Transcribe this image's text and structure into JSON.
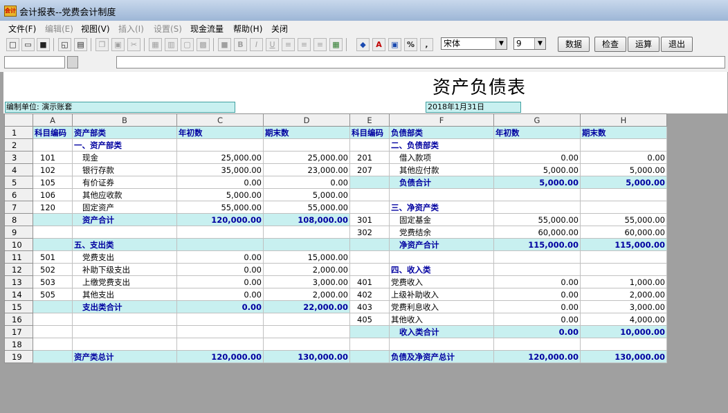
{
  "window": {
    "title": "会计报表--党费会计制度",
    "app_icon_text": "会计"
  },
  "menu": [
    {
      "label": "文件(F)",
      "enabled": true
    },
    {
      "label": "编辑(E)",
      "enabled": false
    },
    {
      "label": "视图(V)",
      "enabled": true
    },
    {
      "label": "插入(I)",
      "enabled": false
    },
    {
      "label": "设置(S)",
      "enabled": false
    },
    {
      "label": "现金流量",
      "enabled": true
    },
    {
      "label": "帮助(H)",
      "enabled": true
    },
    {
      "label": "关闭",
      "enabled": true
    }
  ],
  "toolbar": {
    "icons": [
      "new-icon",
      "open-icon",
      "save-icon",
      "print-preview-icon",
      "print-icon",
      "copy-icon",
      "paste-icon",
      "cut-icon",
      "merge-icon",
      "align-icon",
      "border-icon",
      "style-icon",
      "fill-icon",
      "bold-icon",
      "italic-icon",
      "underline-icon",
      "align-left-icon",
      "align-center-icon",
      "align-right-icon",
      "grid-icon",
      "fill-color-icon",
      "font-color-icon",
      "format-icon",
      "percent-icon",
      "comma-icon"
    ],
    "bold_glyph": "B",
    "italic_glyph": "I",
    "underline_glyph": "U",
    "percent_glyph": "%",
    "comma_glyph": ",",
    "font_name": "宋体",
    "font_size": "9",
    "data_button": "数据",
    "check_button": "检查",
    "calc_button": "运算",
    "exit_button": "退出"
  },
  "formula_bar": {
    "cell_ref": "",
    "formula": ""
  },
  "report": {
    "title": "资产负债表",
    "unit_label": "编制单位: 演示账套",
    "date": "2018年1月31日"
  },
  "columns": [
    "A",
    "B",
    "C",
    "D",
    "E",
    "F",
    "G",
    "H"
  ],
  "rows": [
    {
      "n": "1",
      "a": "科目编码",
      "b": "资产部类",
      "c": "年初数",
      "d": "期末数",
      "e": "科目编码",
      "f": "负债部类",
      "g": "年初数",
      "h": "期末数"
    },
    {
      "n": "2",
      "a": "",
      "b": "一、资产部类",
      "c": "",
      "d": "",
      "e": "",
      "f": "二、负债部类",
      "g": "",
      "h": ""
    },
    {
      "n": "3",
      "a": "101",
      "b": "现金",
      "c": "25,000.00",
      "d": "25,000.00",
      "e": "201",
      "f": "借入款项",
      "g": "0.00",
      "h": "0.00"
    },
    {
      "n": "4",
      "a": "102",
      "b": "银行存款",
      "c": "35,000.00",
      "d": "23,000.00",
      "e": "207",
      "f": "其他应付款",
      "g": "5,000.00",
      "h": "5,000.00"
    },
    {
      "n": "5",
      "a": "105",
      "b": "有价证券",
      "c": "0.00",
      "d": "0.00",
      "e": "",
      "f": "负债合计",
      "g": "5,000.00",
      "h": "5,000.00"
    },
    {
      "n": "6",
      "a": "106",
      "b": "其他应收款",
      "c": "5,000.00",
      "d": "5,000.00",
      "e": "",
      "f": "",
      "g": "",
      "h": ""
    },
    {
      "n": "7",
      "a": "120",
      "b": "固定资产",
      "c": "55,000.00",
      "d": "55,000.00",
      "e": "",
      "f": "三、净资产类",
      "g": "",
      "h": ""
    },
    {
      "n": "8",
      "a": "",
      "b": "资产合计",
      "c": "120,000.00",
      "d": "108,000.00",
      "e": "301",
      "f": "固定基金",
      "g": "55,000.00",
      "h": "55,000.00"
    },
    {
      "n": "9",
      "a": "",
      "b": "",
      "c": "",
      "d": "",
      "e": "302",
      "f": "党费结余",
      "g": "60,000.00",
      "h": "60,000.00"
    },
    {
      "n": "10",
      "a": "",
      "b": "五、支出类",
      "c": "",
      "d": "",
      "e": "",
      "f": "净资产合计",
      "g": "115,000.00",
      "h": "115,000.00"
    },
    {
      "n": "11",
      "a": "501",
      "b": "党费支出",
      "c": "0.00",
      "d": "15,000.00",
      "e": "",
      "f": "",
      "g": "",
      "h": ""
    },
    {
      "n": "12",
      "a": "502",
      "b": "补助下级支出",
      "c": "0.00",
      "d": "2,000.00",
      "e": "",
      "f": "四、收入类",
      "g": "",
      "h": ""
    },
    {
      "n": "13",
      "a": "503",
      "b": "上缴党费支出",
      "c": "0.00",
      "d": "3,000.00",
      "e": "401",
      "f": "党费收入",
      "g": "0.00",
      "h": "1,000.00"
    },
    {
      "n": "14",
      "a": "505",
      "b": "其他支出",
      "c": "0.00",
      "d": "2,000.00",
      "e": "402",
      "f": "上级补助收入",
      "g": "0.00",
      "h": "2,000.00"
    },
    {
      "n": "15",
      "a": "",
      "b": "支出类合计",
      "c": "0.00",
      "d": "22,000.00",
      "e": "403",
      "f": "党费利息收入",
      "g": "0.00",
      "h": "3,000.00"
    },
    {
      "n": "16",
      "a": "",
      "b": "",
      "c": "",
      "d": "",
      "e": "405",
      "f": "其他收入",
      "g": "0.00",
      "h": "4,000.00"
    },
    {
      "n": "17",
      "a": "",
      "b": "",
      "c": "",
      "d": "",
      "e": "",
      "f": "收入类合计",
      "g": "0.00",
      "h": "10,000.00"
    },
    {
      "n": "18",
      "a": "",
      "b": "",
      "c": "",
      "d": "",
      "e": "",
      "f": "",
      "g": "",
      "h": ""
    },
    {
      "n": "19",
      "a": "",
      "b": "资产类总计",
      "c": "120,000.00",
      "d": "130,000.00",
      "e": "",
      "f": "负债及净资产总计",
      "g": "120,000.00",
      "h": "130,000.00"
    }
  ],
  "colors": {
    "highlight_cell": "#c8f0f0",
    "bold_text": "#0000a0",
    "background": "#a0a0a0"
  }
}
